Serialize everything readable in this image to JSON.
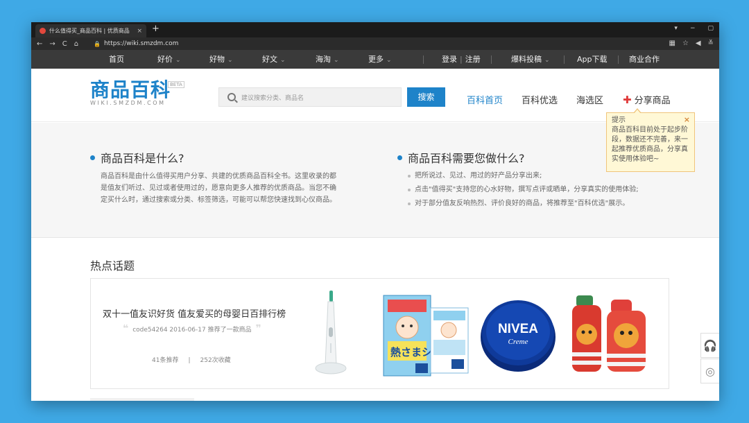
{
  "browser": {
    "tab_title": "什么值得买_商品百科 | 优质商品",
    "tab_close": "×",
    "new_tab": "+",
    "url": "https://wiki.smzdm.com",
    "nav_back": "←",
    "nav_forward": "→",
    "nav_reload": "C",
    "nav_home": "⌂",
    "lock_icon": "🔒",
    "star_icon": "☆",
    "window_controls": [
      "▾",
      "−",
      "▢"
    ],
    "addr_right": [
      "▦",
      "☆",
      "◀",
      "≚"
    ]
  },
  "sitenav": {
    "items": [
      {
        "label": "首页",
        "caret": ""
      },
      {
        "label": "好价",
        "caret": "⌄"
      },
      {
        "label": "好物",
        "caret": "⌄"
      },
      {
        "label": "好文",
        "caret": "⌄"
      },
      {
        "label": "海淘",
        "caret": "⌄"
      },
      {
        "label": "更多",
        "caret": "⌄"
      }
    ],
    "login": "登录",
    "sep": "|",
    "register": "注册",
    "tip_off": "爆料投稿",
    "tip_off_caret": "⌄",
    "app_download": "App下载",
    "business": "商业合作"
  },
  "header": {
    "logo_text": "商品百科",
    "logo_beta": "BETA",
    "logo_sub": "WIKI.SMZDM.COM",
    "search_placeholder": "建议搜索分类、商品名",
    "search_button": "搜索",
    "nav": {
      "home": "百科首页",
      "best": "百科优选",
      "haitao": "海选区",
      "share_plus": "✚",
      "share": "分享商品"
    }
  },
  "tip": {
    "title": "提示",
    "close": "×",
    "text": "商品百科目前处于起步阶段，数据还不完善，来一起推荐优质商品，分享真实使用体验吧~"
  },
  "intro": {
    "left_title": "商品百科是什么?",
    "left_text": "商品百科是由什么值得买用户分享、共建的优质商品百科全书。这里收录的都是值友们听过、见过或者使用过的，愿意向更多人推荐的优质商品。当您不确定买什么时，通过搜索或分类、标签筛选，可能可以帮您快速找到心仪商品。",
    "right_title": "商品百科需要您做什么?",
    "right_items": [
      "把所说过、见过、用过的好产品分享出来;",
      "点击\"值得买\"支持您的心水好物，撰写点评或晒单，分享真实的使用体验;",
      "对于部分值友反响热烈、评价良好的商品，将推荐至\"百科优选\"展示。"
    ]
  },
  "hot": {
    "title": "热点话题",
    "card": {
      "title": "双十一值友识好货 值友爱买的母婴日百排行榜",
      "open_quote": "❝",
      "close_quote": "❞",
      "meta": "code54264 2016-06-17 推荐了一款商品",
      "recommend": "41条推荐",
      "divider": "|",
      "favorites": "252次收藏"
    },
    "product_icons": [
      "toothbrush-image",
      "cooling-patch-image",
      "nivea-tin-image",
      "kids-bottle-image"
    ],
    "nivea_text": "NIVEA",
    "nivea_sub": "Creme",
    "patch_text": "熱さまシート"
  },
  "side": {
    "headset_icon": "🎧",
    "lifebuoy_icon": "◎"
  },
  "colors": {
    "brand_blue": "#1e83c9",
    "nav_dark": "#3a3a3a",
    "accent_red": "#e03b3b",
    "tip_bg": "#fff8d6"
  }
}
